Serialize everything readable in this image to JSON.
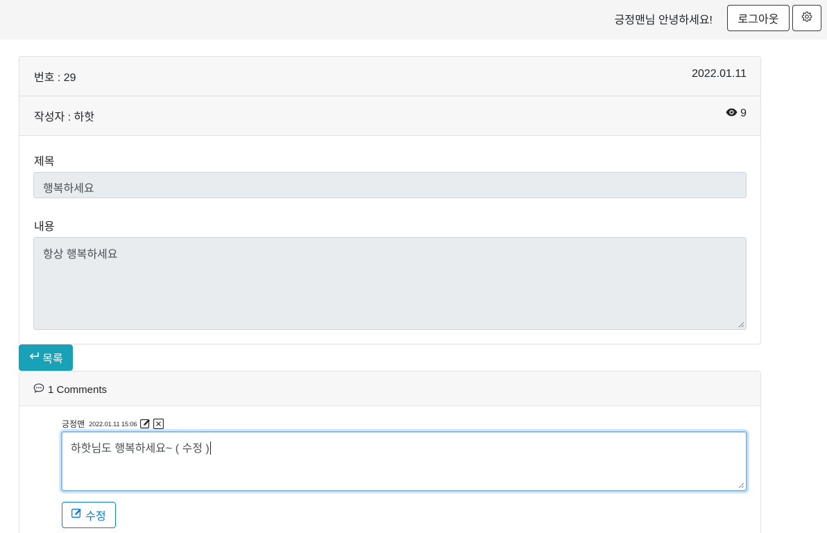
{
  "header": {
    "greeting": "긍정맨님 안녕하세요!",
    "logout_label": "로그아웃",
    "settings_icon": "gear-icon"
  },
  "post": {
    "number_text": "번호 : 29",
    "date": "2022.01.11",
    "author_text": "작성자 : 하핫",
    "views": "9",
    "title_label": "제목",
    "title_value": "행복하세요",
    "content_label": "내용",
    "content_value": "항상 행복하세요"
  },
  "actions": {
    "list_label": "목록"
  },
  "comments": {
    "header": "1 Comments",
    "items": [
      {
        "author": "긍정맨",
        "date": "2022.01.11 15:06",
        "text": "하핫님도 행복하세요~ ( 수정 )"
      }
    ],
    "edit_label": "수정"
  },
  "colors": {
    "accent_teal": "#17a2b8",
    "primary_blue": "#007bff"
  }
}
